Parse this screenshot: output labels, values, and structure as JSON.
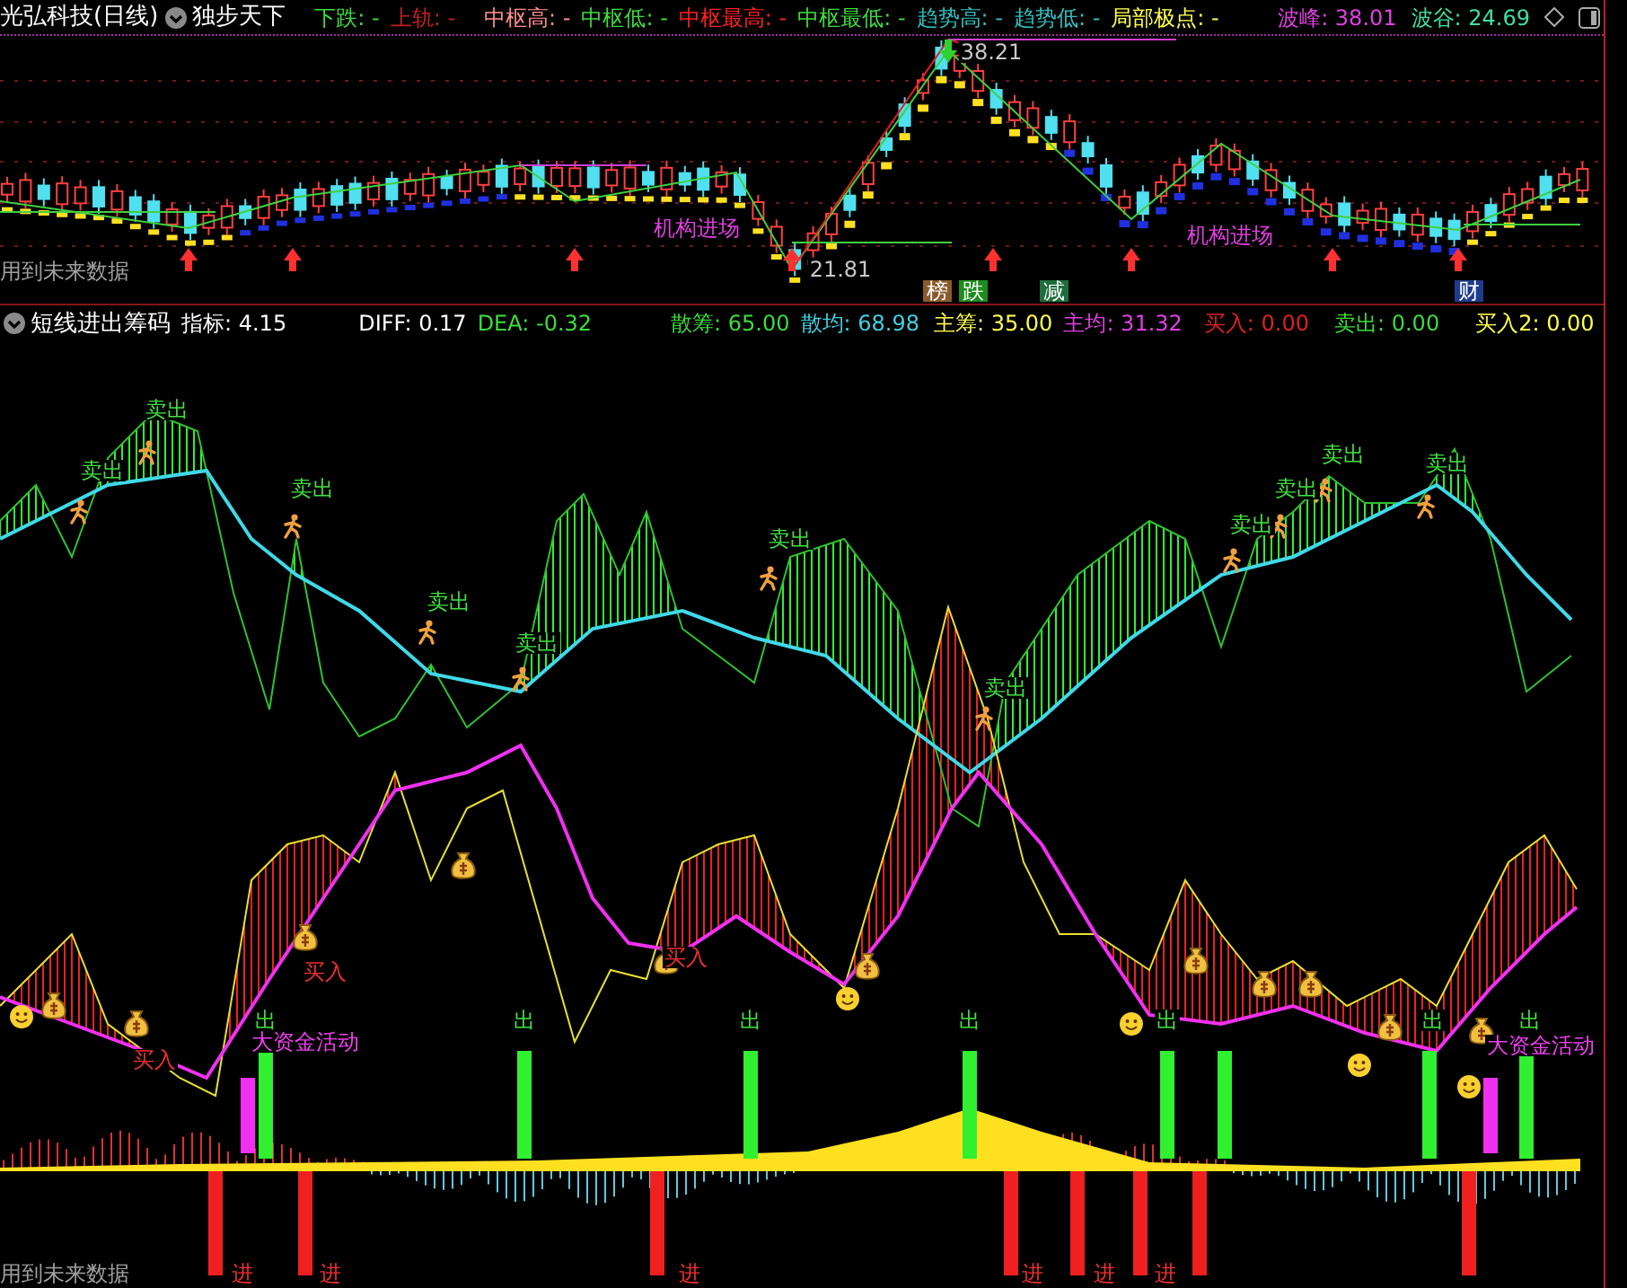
{
  "top_panel": {
    "title": "光弘科技(日线)",
    "indicator": "独步天下",
    "legend": [
      {
        "text": "下跌: -",
        "color": "#3cdc3c"
      },
      {
        "text": "上轨: -",
        "color": "#c02020"
      },
      {
        "text": "中枢高: -",
        "color": "#ff9090"
      },
      {
        "text": "中枢低: -",
        "color": "#3cdc3c"
      },
      {
        "text": "中枢最高: -",
        "color": "#ff2020"
      },
      {
        "text": "中枢最低: -",
        "color": "#3cdc3c"
      },
      {
        "text": "趋势高: -",
        "color": "#30c0c0"
      },
      {
        "text": "趋势低: -",
        "color": "#30c0c0"
      },
      {
        "text": "局部极点: -",
        "color": "#ffff50"
      }
    ],
    "right_legend": [
      {
        "text": "波峰: 38.01",
        "color": "#e040e0"
      },
      {
        "text": "波谷: 24.69",
        "color": "#40e0a0"
      }
    ],
    "price_labels": [
      "38.21",
      "21.81"
    ],
    "tags": [
      "机构进场",
      "机构进场"
    ],
    "badges": [
      {
        "text": "榜",
        "color": "#8b5a2b"
      },
      {
        "text": "跌",
        "color": "#1e8c1e"
      },
      {
        "text": "减",
        "color": "#1e6e3c"
      },
      {
        "text": "财",
        "color": "#1e3c8c"
      }
    ],
    "note": "用到未来数据"
  },
  "bottom_panel": {
    "title": "短线进出筹码",
    "legend": [
      {
        "text": "指标: 4.15",
        "color": "#ffffff"
      },
      {
        "text": "DIFF: 0.17",
        "color": "#ffffff"
      },
      {
        "text": "DEA: -0.32",
        "color": "#3cdc3c"
      },
      {
        "text": "散筹: 65.00",
        "color": "#3cdc3c"
      },
      {
        "text": "散均: 68.98",
        "color": "#40d0e0"
      },
      {
        "text": "主筹: 35.00",
        "color": "#ffff50"
      },
      {
        "text": "主均: 31.32",
        "color": "#e040e0"
      },
      {
        "text": "买入: 0.00",
        "color": "#e02020"
      },
      {
        "text": "卖出: 0.00",
        "color": "#3cdc3c"
      },
      {
        "text": "买入2: 0.00",
        "color": "#ffff50"
      }
    ],
    "sell_labels": [
      "卖出",
      "卖出",
      "卖出",
      "卖出",
      "卖出",
      "卖出",
      "卖出",
      "卖出",
      "卖出",
      "卖出",
      "卖出"
    ],
    "buy_labels": [
      "买入",
      "买入",
      "买入"
    ],
    "fund_labels": [
      "大资金活动",
      "大资金活动"
    ],
    "out_labels": [
      "出",
      "出",
      "出",
      "出",
      "出",
      "出",
      "出"
    ],
    "in_labels": [
      "进",
      "进",
      "进",
      "进",
      "进",
      "进"
    ],
    "note": "用到未来数据"
  }
}
